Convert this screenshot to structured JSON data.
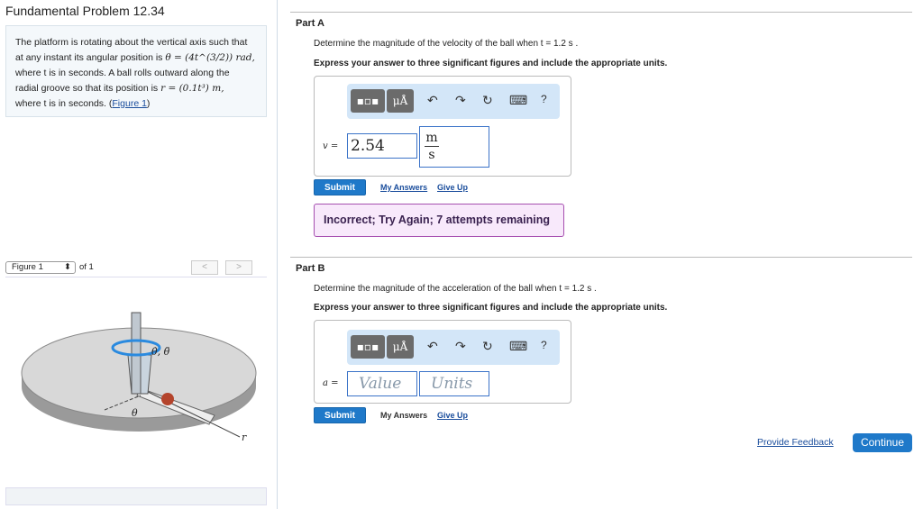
{
  "title": "Fundamental Problem 12.34",
  "problem": {
    "l1": "The platform is rotating about the vertical axis such that",
    "l2a": "at any instant its angular position is ",
    "l2m": "θ = (4t^(3/2)) rad,",
    "l3": "where t is in seconds. A ball rolls outward along the",
    "l4a": "radial groove so that its position is ",
    "l4m": "r = (0.1t³) m,",
    "l5a": "where t is in seconds. (",
    "link": "Figure 1",
    "l5b": ")"
  },
  "figure": {
    "select": "Figure 1",
    "of": "of 1",
    "prev": "<",
    "next": ">",
    "labels": {
      "theta_dots": "θ̇, θ̈",
      "theta": "θ",
      "r": "r"
    }
  },
  "toolbar": {
    "templates": "templates",
    "units": "μÅ",
    "undo": "↶",
    "redo": "↷",
    "reset": "↻",
    "keyboard": "⌨",
    "help": "?"
  },
  "partA": {
    "label": "Part A",
    "question": "Determine the magnitude of the velocity of the ball when t = 1.2 s .",
    "instruction": "Express your answer to three significant figures and include the appropriate units.",
    "var": "v =",
    "value": "2.54",
    "unit_num": "m",
    "unit_den": "s",
    "submit": "Submit",
    "my_answers": "My Answers",
    "give_up": "Give Up",
    "feedback": "Incorrect; Try Again; 7 attempts remaining"
  },
  "partB": {
    "label": "Part B",
    "question": "Determine the magnitude of the acceleration of the ball when t = 1.2 s .",
    "instruction": "Express your answer to three significant figures and include the appropriate units.",
    "var": "a =",
    "value_placeholder": "Value",
    "units_placeholder": "Units",
    "submit": "Submit",
    "my_answers": "My Answers",
    "give_up": "Give Up"
  },
  "footer": {
    "feedback": "Provide Feedback",
    "continue": "Continue"
  }
}
